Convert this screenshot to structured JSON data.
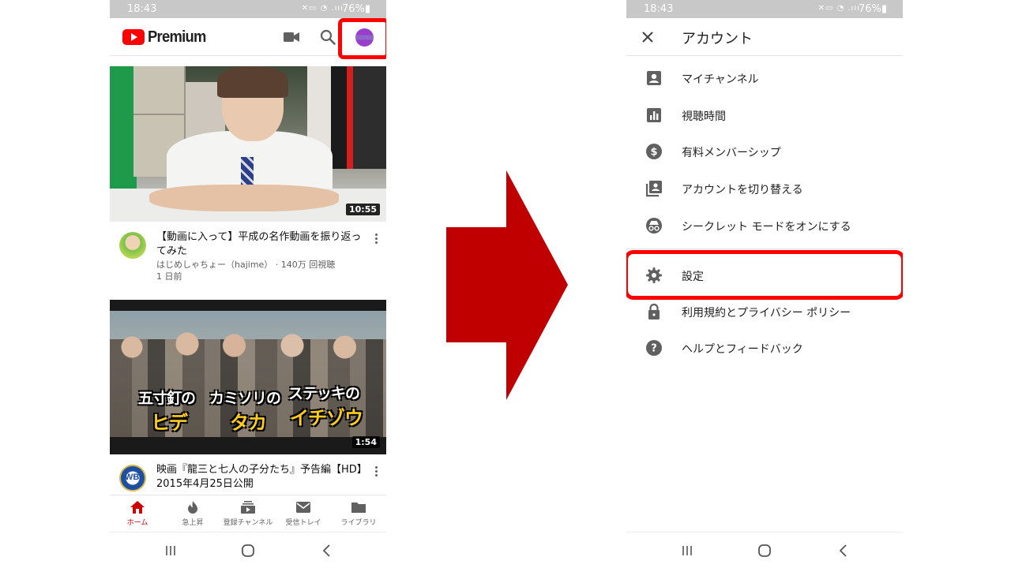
{
  "left_phone": {
    "status_bar": {
      "time": "18:43",
      "icons": "✕▭ ◔ .ııı",
      "battery": "76%▮"
    },
    "header": {
      "brand": "Premium",
      "cam_icon": "video-camera-icon",
      "search_icon": "search-icon"
    },
    "videos": [
      {
        "duration": "10:55",
        "title": "【動画に入って】平成の名作動画を振り返ってみた",
        "channel_views": "はじめしゃちょー（hajime） · 140万 回視聴",
        "age": "1 日前"
      },
      {
        "duration": "1:54",
        "title": "映画『龍三と七人の子分たち』予告編【HD】2015年4月25日公開",
        "channel_logo": "WB",
        "overlay": [
          {
            "top": "五寸釘の",
            "bottom": "ヒデ"
          },
          {
            "top": "カミソリの",
            "bottom": "タカ"
          },
          {
            "top": "ステッキの",
            "bottom": "イチゾウ"
          }
        ]
      }
    ],
    "bottom_nav": [
      {
        "label": "ホーム",
        "icon": "home-icon",
        "active": true
      },
      {
        "label": "急上昇",
        "icon": "trending-flame-icon",
        "active": false
      },
      {
        "label": "登録チャンネル",
        "icon": "subscriptions-icon",
        "active": false
      },
      {
        "label": "受信トレイ",
        "icon": "inbox-mail-icon",
        "active": false
      },
      {
        "label": "ライブラリ",
        "icon": "library-folder-icon",
        "active": false
      }
    ]
  },
  "right_phone": {
    "status_bar": {
      "time": "18:43",
      "icons": "✕▭ ◔ .ııı",
      "battery": "76%▮"
    },
    "header": {
      "title": "アカウント",
      "close_icon": "close-icon"
    },
    "menu": [
      {
        "label": "マイチャンネル",
        "icon": "account-box-icon"
      },
      {
        "label": "視聴時間",
        "icon": "bar-chart-icon"
      },
      {
        "label": "有料メンバーシップ",
        "icon": "dollar-circle-icon"
      },
      {
        "label": "アカウントを切り替える",
        "icon": "switch-account-icon"
      },
      {
        "label": "シークレット モードをオンにする",
        "icon": "incognito-icon"
      },
      {
        "label": "設定",
        "icon": "gear-icon"
      },
      {
        "label": "利用規約とプライバシー ポリシー",
        "icon": "lock-icon"
      },
      {
        "label": "ヘルプとフィードバック",
        "icon": "help-circle-icon"
      }
    ]
  },
  "colors": {
    "youtube_red": "#ff0000",
    "highlight_red": "#ff0000",
    "arrow_red": "#c00000",
    "icon_gray": "#606060"
  }
}
